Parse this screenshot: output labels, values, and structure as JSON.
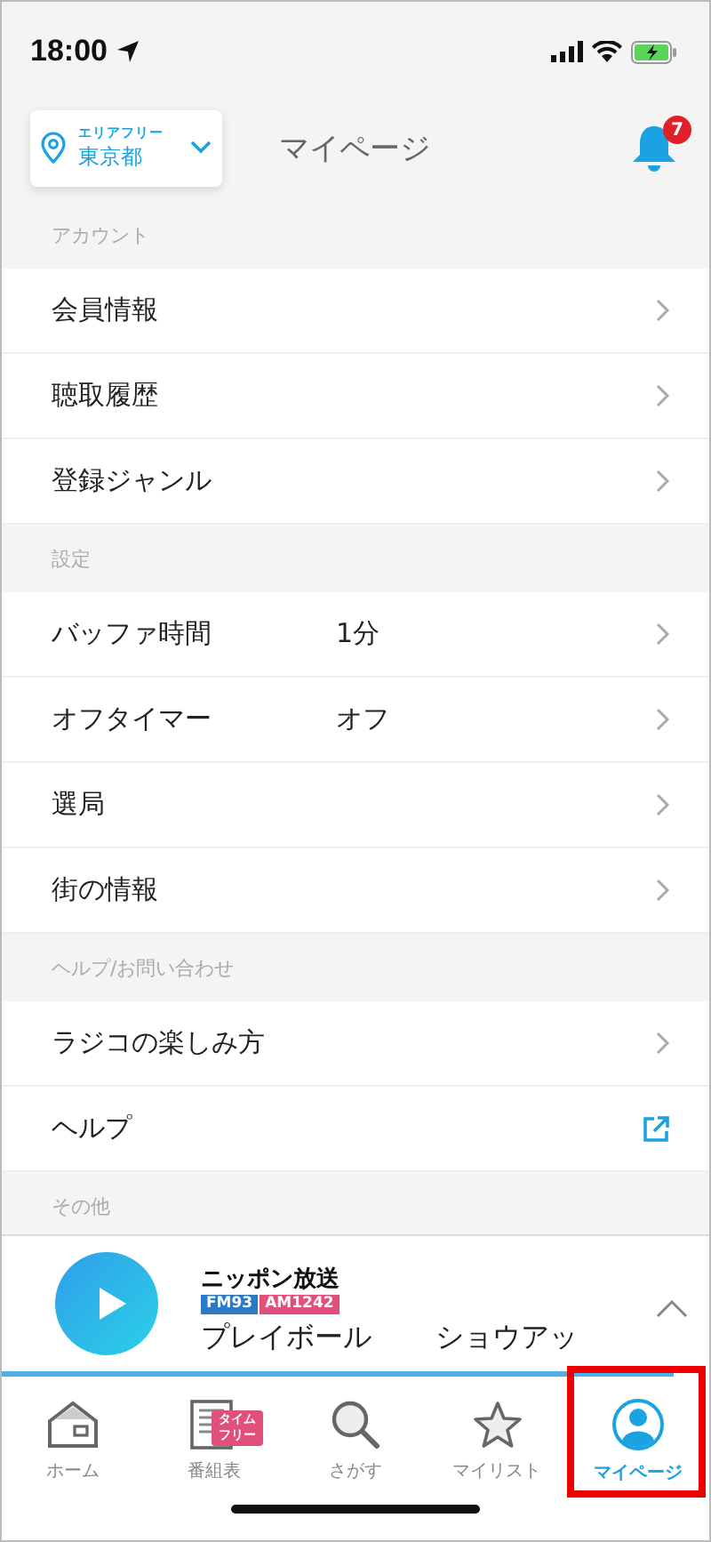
{
  "status_bar": {
    "time": "18:00"
  },
  "header": {
    "area_label": "エリアフリー",
    "area": "東京都",
    "title": "マイページ",
    "notification_count": "7"
  },
  "sections": [
    {
      "title": "アカウント",
      "items": [
        {
          "label": "会員情報",
          "kind": "chevron"
        },
        {
          "label": "聴取履歴",
          "kind": "chevron"
        },
        {
          "label": "登録ジャンル",
          "kind": "chevron"
        }
      ]
    },
    {
      "title": "設定",
      "items": [
        {
          "label": "バッファ時間",
          "value": "1分",
          "kind": "chevron"
        },
        {
          "label": "オフタイマー",
          "value": "オフ",
          "kind": "chevron"
        },
        {
          "label": "選局",
          "kind": "chevron"
        },
        {
          "label": "街の情報",
          "kind": "chevron"
        }
      ]
    },
    {
      "title": "ヘルプ/お問い合わせ",
      "items": [
        {
          "label": "ラジコの楽しみ方",
          "kind": "chevron"
        },
        {
          "label": "ヘルプ",
          "kind": "external"
        }
      ]
    },
    {
      "title": "その他"
    }
  ],
  "player": {
    "station": "ニッポン放送",
    "fm": "FM93",
    "am": "AM1242",
    "program": "プレイボール",
    "program_2": "ショウアッ",
    "level": 0.95
  },
  "tabs": [
    {
      "label": "ホーム",
      "selected": false
    },
    {
      "label": "番組表",
      "badge": "タイムフリー",
      "selected": false
    },
    {
      "label": "さがす",
      "selected": false
    },
    {
      "label": "マイリスト",
      "selected": false
    },
    {
      "label": "マイページ",
      "selected": true,
      "highlighted": true
    }
  ]
}
